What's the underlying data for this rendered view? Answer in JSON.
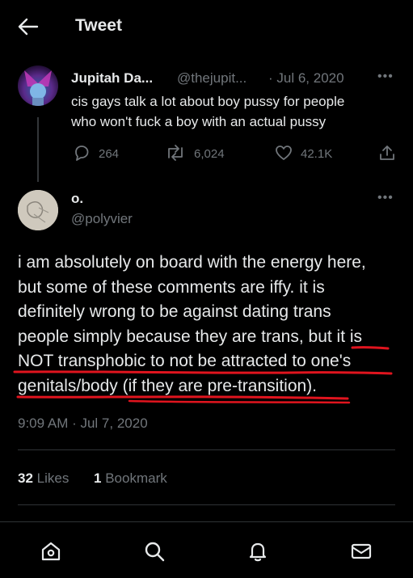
{
  "header": {
    "title": "Tweet"
  },
  "parent_tweet": {
    "display_name": "Jupitah Da...",
    "handle": "@thejupit...",
    "date": "· Jul 6, 2020",
    "text_line1": "cis gays talk a lot about boy pussy for people",
    "text_line2": "who won't fuck a boy with an actual pussy",
    "replies": "264",
    "retweets": "6,024",
    "likes": "42.1K"
  },
  "reply_tweet": {
    "display_name": "o.",
    "handle": "@polyvier",
    "lines": [
      "i am absolutely on board with the energy here,",
      "but some of these comments are iffy. it is",
      "definitely wrong to be against dating trans",
      "people simply because they are trans, but it is",
      "NOT transphobic to not be attracted to one's",
      "genitals/body (if they are pre-transition)."
    ],
    "timestamp": "9:09 AM · Jul 7, 2020",
    "likes_count": "32",
    "likes_label": "Likes",
    "bookmarks_count": "1",
    "bookmarks_label": "Bookmark"
  },
  "colors": {
    "background": "#000000",
    "text": "#e7e9ea",
    "muted": "#71767b",
    "annotation": "#e0141e"
  },
  "icons": [
    "back-arrow-icon",
    "reply-icon",
    "retweet-icon",
    "like-icon",
    "share-icon",
    "more-icon",
    "home-icon",
    "search-icon",
    "notifications-icon",
    "messages-icon"
  ]
}
